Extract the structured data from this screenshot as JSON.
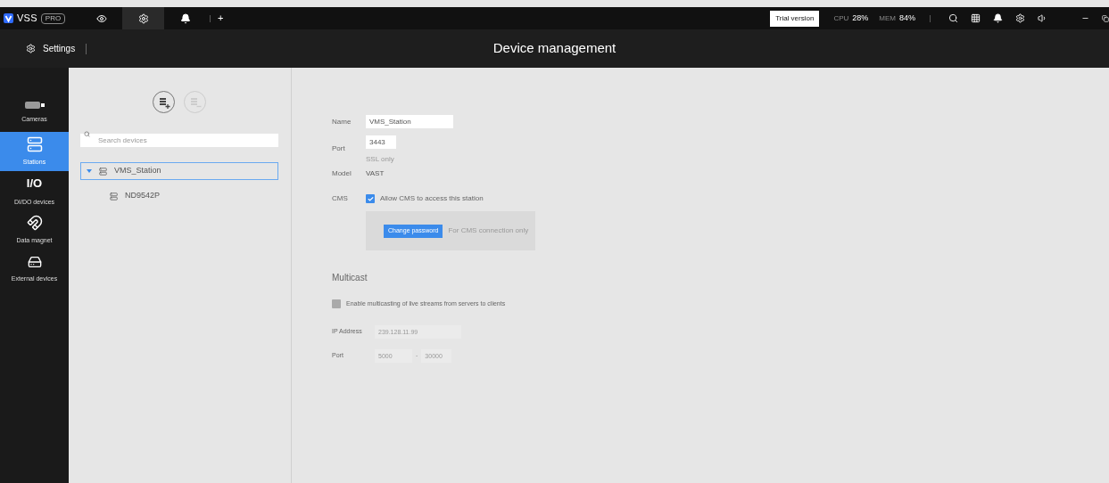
{
  "topbar": {
    "logo": "VSS",
    "edition": "PRO",
    "tabs": [
      {
        "kind": "eye",
        "selected": false
      },
      {
        "kind": "gear",
        "selected": true
      },
      {
        "kind": "bell",
        "selected": false
      }
    ],
    "add": "+",
    "trial": "Trial version",
    "cpu_label": "CPU",
    "cpu": "28%",
    "mem_label": "MEM",
    "mem": "84%"
  },
  "header": {
    "section": "Settings",
    "title": "Device management"
  },
  "sidebar": {
    "items": [
      {
        "kind": "camera",
        "label": "Cameras",
        "selected": false
      },
      {
        "kind": "station",
        "label": "Stations",
        "selected": true
      },
      {
        "kind": "io",
        "glyph": "I/O",
        "label": "DI/DO devices",
        "selected": false
      },
      {
        "kind": "magnet",
        "label": "Data magnet",
        "selected": false
      },
      {
        "kind": "external",
        "label": "External devices",
        "selected": false
      }
    ]
  },
  "tree": {
    "add_disabled": false,
    "remove_disabled": true,
    "search_placeholder": "Search devices",
    "nodes": [
      {
        "label": "VMS_Station",
        "expanded": true,
        "selected": true,
        "children": [
          {
            "label": "ND9542P",
            "selected": false
          }
        ]
      }
    ]
  },
  "form": {
    "name_label": "Name",
    "name": "VMS_Station",
    "port_label": "Port",
    "port": "3443",
    "port_hint": "SSL only",
    "model_label": "Model",
    "model": "VAST",
    "cms_label": "CMS",
    "cms_checkbox": "Allow CMS to access this station",
    "cms_checked": true,
    "change_password": "Change password",
    "change_hint": "For CMS connection only"
  },
  "multicast": {
    "title": "Multicast",
    "checkbox": "Enable multicasting of live streams from servers to clients",
    "checked": false,
    "ip_label": "IP Address",
    "ip": "239.128.11.99",
    "port_label": "Port",
    "port_from": "5000",
    "separator": "-",
    "port_to": "30000"
  }
}
